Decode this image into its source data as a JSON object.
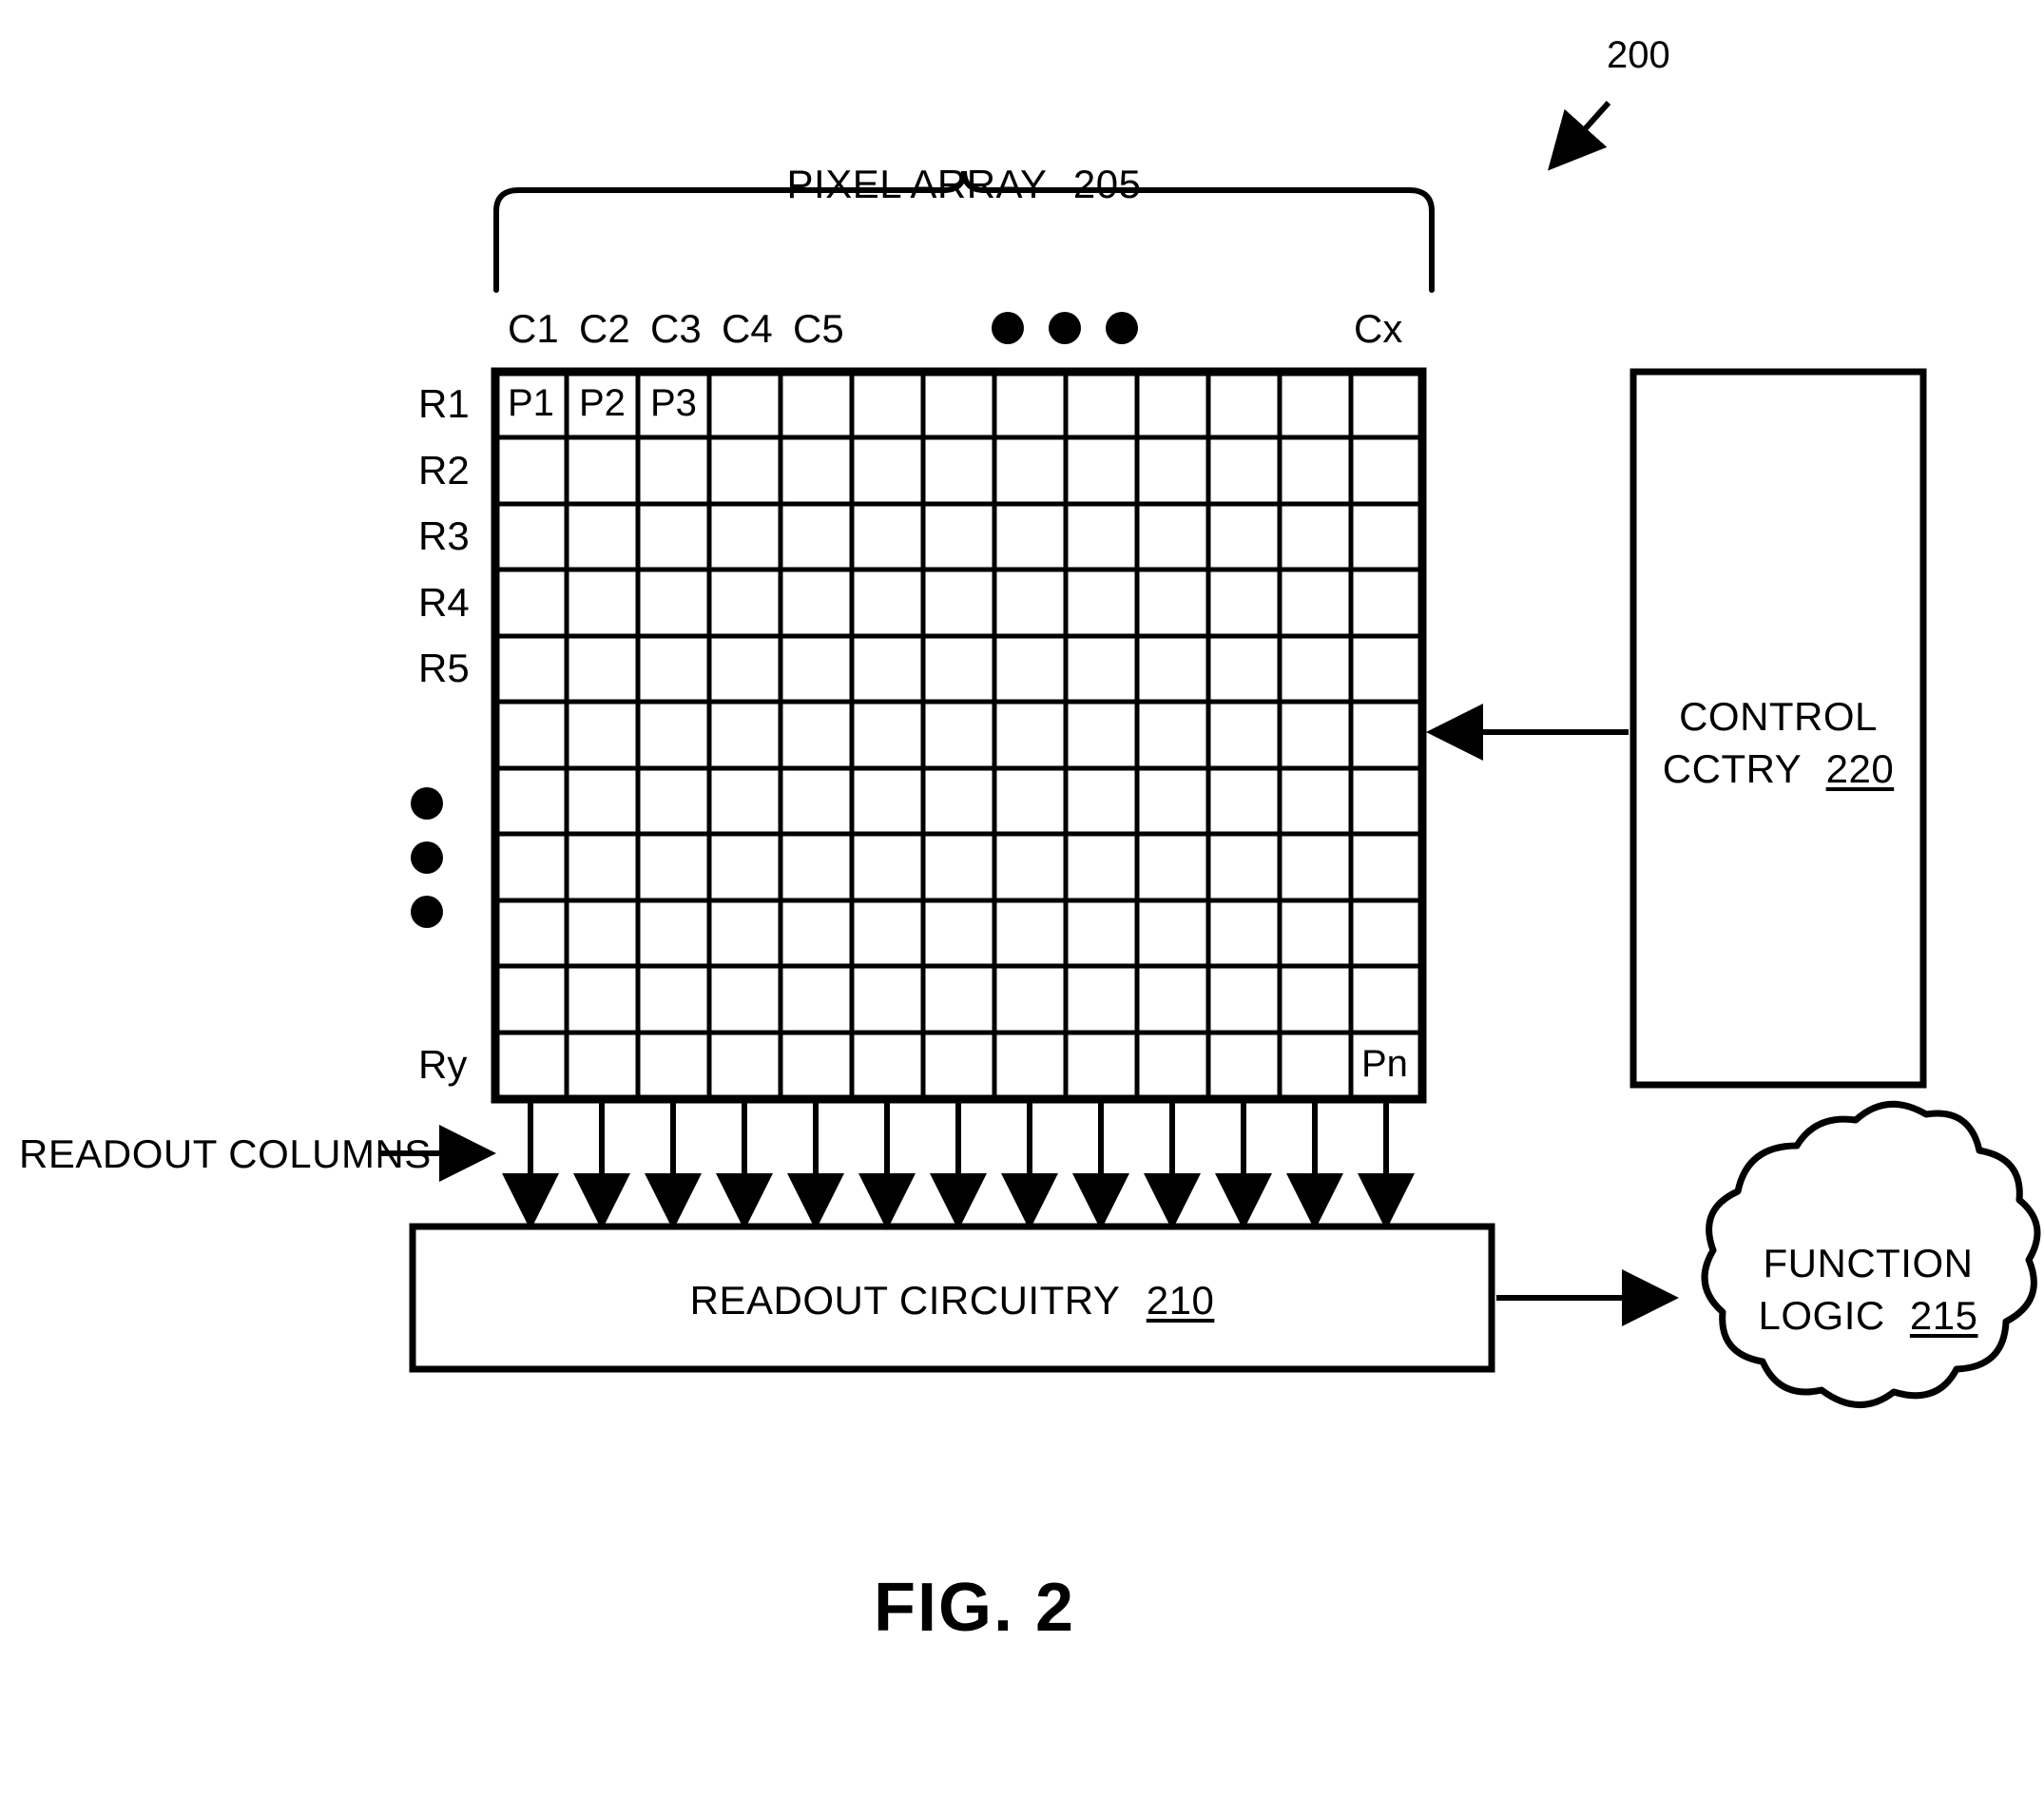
{
  "figure": {
    "number": "FIG. 2",
    "system_ref": "200"
  },
  "pixel_array": {
    "title": "PIXEL ARRAY",
    "ref": "205",
    "column_labels": [
      "C1",
      "C2",
      "C3",
      "C4",
      "C5"
    ],
    "column_last_label": "Cx",
    "column_ellipsis_dots": 3,
    "row_labels": [
      "R1",
      "R2",
      "R3",
      "R4",
      "R5"
    ],
    "row_last_label": "Ry",
    "row_ellipsis_dots": 3,
    "grid_columns": 13,
    "grid_rows": 11,
    "first_row_cells": [
      "P1",
      "P2",
      "P3"
    ],
    "last_cell": "Pn"
  },
  "readout_columns": {
    "label": "READOUT COLUMNS",
    "arrow_count": 13
  },
  "readout_circuitry": {
    "title": "READOUT CIRCUITRY",
    "ref": "210"
  },
  "function_logic": {
    "line1": "FUNCTION",
    "line2": "LOGIC",
    "ref": "215"
  },
  "control_circuitry": {
    "line1": "CONTROL",
    "line2": "CCTRY",
    "ref": "220"
  },
  "colors": {
    "stroke": "#000000",
    "background": "#ffffff"
  }
}
